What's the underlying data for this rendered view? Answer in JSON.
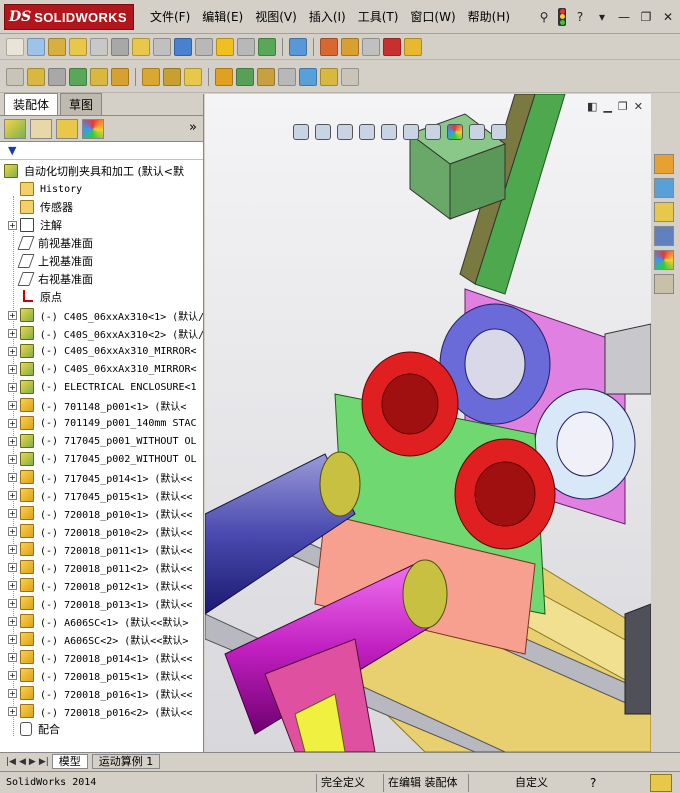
{
  "app": {
    "brand_prefix": "DS",
    "brand_name": "SOLIDWORKS",
    "menu": [
      "文件(F)",
      "编辑(E)",
      "视图(V)",
      "插入(I)",
      "工具(T)",
      "窗口(W)",
      "帮助(H)"
    ]
  },
  "panel": {
    "tabs": [
      "装配体",
      "草图"
    ],
    "more": "»",
    "filter": "▼"
  },
  "tree": {
    "root": "自动化切削夹具和加工  (默认<默",
    "items": [
      {
        "label": "History",
        "icon": "history-icon",
        "kind": "folder",
        "expander": ""
      },
      {
        "label": "传感器",
        "icon": "sensor-icon",
        "kind": "folder",
        "expander": ""
      },
      {
        "label": "注解",
        "icon": "annotation-icon",
        "kind": "note",
        "expander": "+"
      },
      {
        "label": "前视基准面",
        "icon": "plane-icon",
        "kind": "plane",
        "expander": ""
      },
      {
        "label": "上视基准面",
        "icon": "plane-icon",
        "kind": "plane",
        "expander": ""
      },
      {
        "label": "右视基准面",
        "icon": "plane-icon",
        "kind": "plane",
        "expander": ""
      },
      {
        "label": "原点",
        "icon": "origin-icon",
        "kind": "origin",
        "expander": ""
      },
      {
        "label": "(-) C40S_06xxAx310<1> (默认/",
        "icon": "subassembly-icon",
        "kind": "asm",
        "expander": "+"
      },
      {
        "label": "(-) C40S_06xxAx310<2> (默认/",
        "icon": "subassembly-icon",
        "kind": "asm",
        "expander": "+"
      },
      {
        "label": "(-) C40S_06xxAx310_MIRROR<",
        "icon": "subassembly-icon",
        "kind": "asm",
        "expander": "+"
      },
      {
        "label": "(-) C40S_06xxAx310_MIRROR<",
        "icon": "subassembly-icon",
        "kind": "asm",
        "expander": "+"
      },
      {
        "label": "(-) ELECTRICAL ENCLOSURE<1",
        "icon": "subassembly-icon",
        "kind": "asm",
        "expander": "+"
      },
      {
        "label": "(-) 701148_p001<1> (默认<",
        "icon": "part-icon",
        "kind": "part",
        "expander": "+"
      },
      {
        "label": "(-) 701149_p001_140mm STAC",
        "icon": "part-icon",
        "kind": "part",
        "expander": "+"
      },
      {
        "label": "(-) 717045_p001_WITHOUT OL",
        "icon": "subassembly-icon",
        "kind": "asm",
        "expander": "+"
      },
      {
        "label": "(-) 717045_p002_WITHOUT OL",
        "icon": "subassembly-icon",
        "kind": "asm",
        "expander": "+"
      },
      {
        "label": "(-) 717045_p014<1> (默认<<",
        "icon": "part-icon",
        "kind": "part",
        "expander": "+"
      },
      {
        "label": "(-) 717045_p015<1> (默认<<",
        "icon": "part-icon",
        "kind": "part",
        "expander": "+"
      },
      {
        "label": "(-) 720018_p010<1> (默认<<",
        "icon": "part-icon",
        "kind": "part",
        "expander": "+"
      },
      {
        "label": "(-) 720018_p010<2> (默认<<",
        "icon": "part-icon",
        "kind": "part",
        "expander": "+"
      },
      {
        "label": "(-) 720018_p011<1> (默认<<",
        "icon": "part-icon",
        "kind": "part",
        "expander": "+"
      },
      {
        "label": "(-) 720018_p011<2> (默认<<",
        "icon": "part-icon",
        "kind": "part",
        "expander": "+"
      },
      {
        "label": "(-) 720018_p012<1> (默认<<",
        "icon": "part-icon",
        "kind": "part",
        "expander": "+"
      },
      {
        "label": "(-) 720018_p013<1> (默认<<",
        "icon": "part-icon",
        "kind": "part",
        "expander": "+"
      },
      {
        "label": "(-) A606SC<1> (默认<<默认>",
        "icon": "part-icon",
        "kind": "part",
        "expander": "+"
      },
      {
        "label": "(-) A606SC<2> (默认<<默认>",
        "icon": "part-icon",
        "kind": "part",
        "expander": "+"
      },
      {
        "label": "(-) 720018_p014<1> (默认<<",
        "icon": "part-icon",
        "kind": "part",
        "expander": "+"
      },
      {
        "label": "(-) 720018_p015<1> (默认<<",
        "icon": "part-icon",
        "kind": "part",
        "expander": "+"
      },
      {
        "label": "(-) 720018_p016<1> (默认<<",
        "icon": "part-icon",
        "kind": "part",
        "expander": "+"
      },
      {
        "label": "(-) 720018_p016<2> (默认<<",
        "icon": "part-icon",
        "kind": "part",
        "expander": "+"
      },
      {
        "label": "配合",
        "icon": "mates-icon",
        "kind": "mate",
        "expander": ""
      }
    ]
  },
  "bottom_tabs": [
    "模型",
    "运动算例 1"
  ],
  "status": {
    "app_version": "SolidWorks 2014",
    "fully_defined": "完全定义",
    "editing": "在编辑 装配体",
    "custom": "自定义",
    "help": "?"
  }
}
